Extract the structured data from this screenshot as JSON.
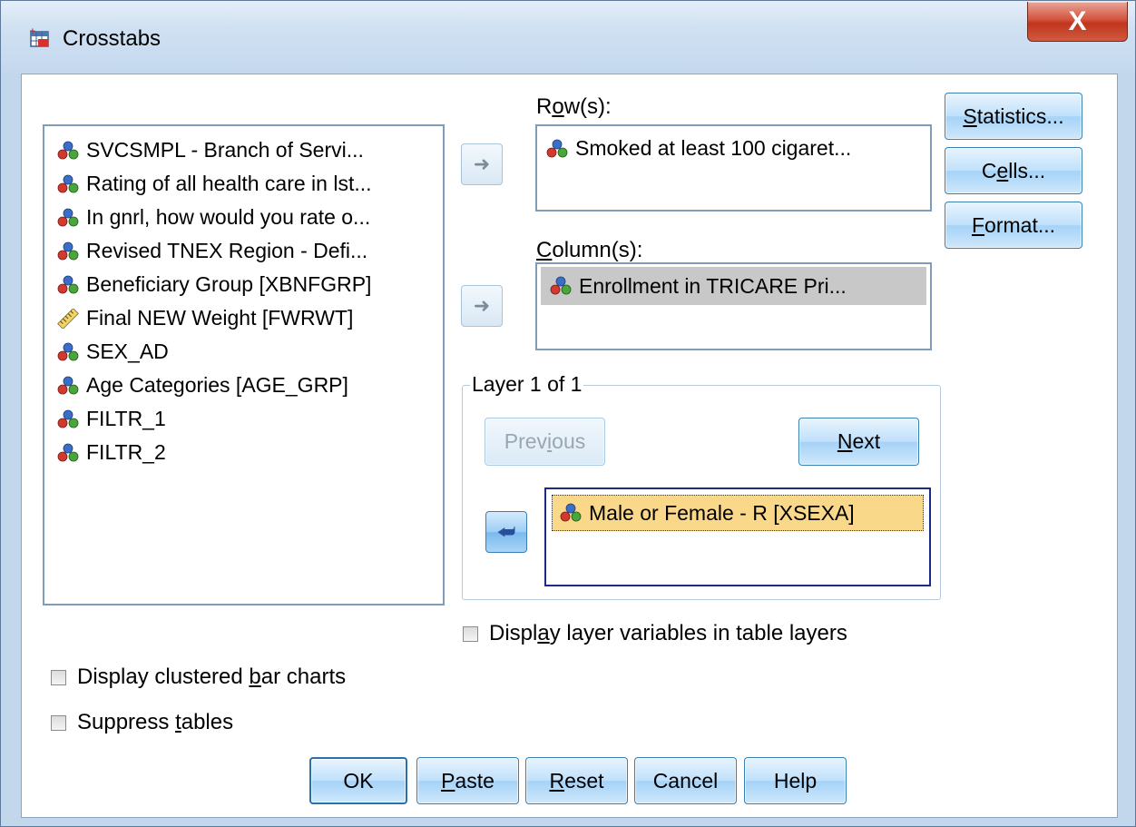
{
  "window": {
    "title": "Crosstabs",
    "close_glyph": "X"
  },
  "source_list": {
    "items": [
      {
        "label": "SVCSMPL - Branch of Servi...",
        "icon": "nominal-variable-icon"
      },
      {
        "label": "Rating of all health care in lst...",
        "icon": "nominal-variable-icon"
      },
      {
        "label": "In gnrl, how would you rate o...",
        "icon": "nominal-variable-icon"
      },
      {
        "label": "Revised TNEX Region - Defi...",
        "icon": "nominal-variable-icon"
      },
      {
        "label": "Beneficiary Group [XBNFGRP]",
        "icon": "nominal-variable-icon"
      },
      {
        "label": "Final NEW Weight [FWRWT]",
        "icon": "scale-variable-icon"
      },
      {
        "label": "SEX_AD",
        "icon": "nominal-variable-icon"
      },
      {
        "label": "Age Categories [AGE_GRP]",
        "icon": "nominal-variable-icon"
      },
      {
        "label": "FILTR_1",
        "icon": "nominal-variable-icon"
      },
      {
        "label": "FILTR_2",
        "icon": "nominal-variable-icon"
      }
    ]
  },
  "rows": {
    "label_pre": "R",
    "label_u": "o",
    "label_post": "w(s):",
    "item": "Smoked at least 100 cigaret..."
  },
  "columns": {
    "label_pre": "",
    "label_u": "C",
    "label_post": "olumn(s):",
    "item": "Enrollment in TRICARE Pri..."
  },
  "layer": {
    "legend": "Layer 1 of 1",
    "previous_pre": "Prev",
    "previous_u": "i",
    "previous_post": "ous",
    "next_u": "N",
    "next_post": "ext",
    "item": "Male or Female  - R [XSEXA]"
  },
  "side_buttons": {
    "statistics_u": "S",
    "statistics_post": "tatistics...",
    "cells_pre": "C",
    "cells_u": "e",
    "cells_post": "lls...",
    "format_u": "F",
    "format_post": "ormat..."
  },
  "checkboxes": {
    "layer_vars_pre": "Displ",
    "layer_vars_u": "a",
    "layer_vars_post": "y layer variables in table layers",
    "clustered_pre": "Display clustered ",
    "clustered_u": "b",
    "clustered_post": "ar charts",
    "suppress_pre": "Suppress ",
    "suppress_u": "t",
    "suppress_post": "ables"
  },
  "footer": {
    "ok": "OK",
    "paste_u": "P",
    "paste_post": "aste",
    "reset_u": "R",
    "reset_post": "eset",
    "cancel": "Cancel",
    "help": "Help"
  }
}
